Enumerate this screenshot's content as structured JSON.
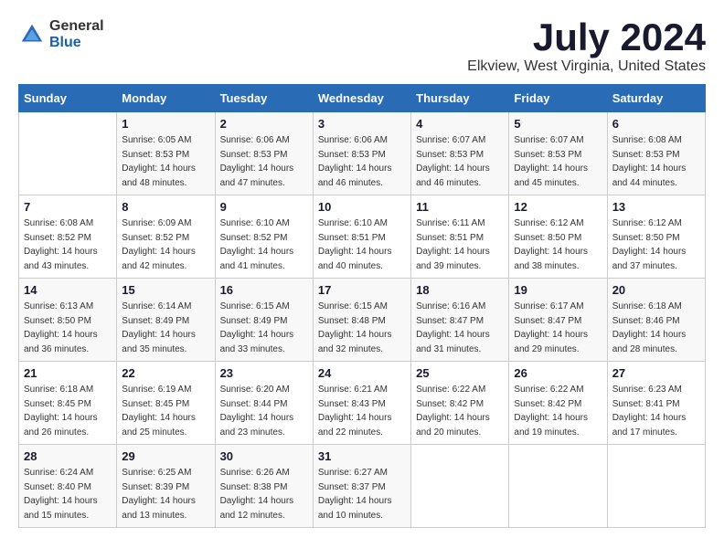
{
  "header": {
    "logo_general": "General",
    "logo_blue": "Blue",
    "month_year": "July 2024",
    "location": "Elkview, West Virginia, United States"
  },
  "weekdays": [
    "Sunday",
    "Monday",
    "Tuesday",
    "Wednesday",
    "Thursday",
    "Friday",
    "Saturday"
  ],
  "weeks": [
    [
      {
        "day": "",
        "sunrise": "",
        "sunset": "",
        "daylight": ""
      },
      {
        "day": "1",
        "sunrise": "Sunrise: 6:05 AM",
        "sunset": "Sunset: 8:53 PM",
        "daylight": "Daylight: 14 hours and 48 minutes."
      },
      {
        "day": "2",
        "sunrise": "Sunrise: 6:06 AM",
        "sunset": "Sunset: 8:53 PM",
        "daylight": "Daylight: 14 hours and 47 minutes."
      },
      {
        "day": "3",
        "sunrise": "Sunrise: 6:06 AM",
        "sunset": "Sunset: 8:53 PM",
        "daylight": "Daylight: 14 hours and 46 minutes."
      },
      {
        "day": "4",
        "sunrise": "Sunrise: 6:07 AM",
        "sunset": "Sunset: 8:53 PM",
        "daylight": "Daylight: 14 hours and 46 minutes."
      },
      {
        "day": "5",
        "sunrise": "Sunrise: 6:07 AM",
        "sunset": "Sunset: 8:53 PM",
        "daylight": "Daylight: 14 hours and 45 minutes."
      },
      {
        "day": "6",
        "sunrise": "Sunrise: 6:08 AM",
        "sunset": "Sunset: 8:53 PM",
        "daylight": "Daylight: 14 hours and 44 minutes."
      }
    ],
    [
      {
        "day": "7",
        "sunrise": "Sunrise: 6:08 AM",
        "sunset": "Sunset: 8:52 PM",
        "daylight": "Daylight: 14 hours and 43 minutes."
      },
      {
        "day": "8",
        "sunrise": "Sunrise: 6:09 AM",
        "sunset": "Sunset: 8:52 PM",
        "daylight": "Daylight: 14 hours and 42 minutes."
      },
      {
        "day": "9",
        "sunrise": "Sunrise: 6:10 AM",
        "sunset": "Sunset: 8:52 PM",
        "daylight": "Daylight: 14 hours and 41 minutes."
      },
      {
        "day": "10",
        "sunrise": "Sunrise: 6:10 AM",
        "sunset": "Sunset: 8:51 PM",
        "daylight": "Daylight: 14 hours and 40 minutes."
      },
      {
        "day": "11",
        "sunrise": "Sunrise: 6:11 AM",
        "sunset": "Sunset: 8:51 PM",
        "daylight": "Daylight: 14 hours and 39 minutes."
      },
      {
        "day": "12",
        "sunrise": "Sunrise: 6:12 AM",
        "sunset": "Sunset: 8:50 PM",
        "daylight": "Daylight: 14 hours and 38 minutes."
      },
      {
        "day": "13",
        "sunrise": "Sunrise: 6:12 AM",
        "sunset": "Sunset: 8:50 PM",
        "daylight": "Daylight: 14 hours and 37 minutes."
      }
    ],
    [
      {
        "day": "14",
        "sunrise": "Sunrise: 6:13 AM",
        "sunset": "Sunset: 8:50 PM",
        "daylight": "Daylight: 14 hours and 36 minutes."
      },
      {
        "day": "15",
        "sunrise": "Sunrise: 6:14 AM",
        "sunset": "Sunset: 8:49 PM",
        "daylight": "Daylight: 14 hours and 35 minutes."
      },
      {
        "day": "16",
        "sunrise": "Sunrise: 6:15 AM",
        "sunset": "Sunset: 8:49 PM",
        "daylight": "Daylight: 14 hours and 33 minutes."
      },
      {
        "day": "17",
        "sunrise": "Sunrise: 6:15 AM",
        "sunset": "Sunset: 8:48 PM",
        "daylight": "Daylight: 14 hours and 32 minutes."
      },
      {
        "day": "18",
        "sunrise": "Sunrise: 6:16 AM",
        "sunset": "Sunset: 8:47 PM",
        "daylight": "Daylight: 14 hours and 31 minutes."
      },
      {
        "day": "19",
        "sunrise": "Sunrise: 6:17 AM",
        "sunset": "Sunset: 8:47 PM",
        "daylight": "Daylight: 14 hours and 29 minutes."
      },
      {
        "day": "20",
        "sunrise": "Sunrise: 6:18 AM",
        "sunset": "Sunset: 8:46 PM",
        "daylight": "Daylight: 14 hours and 28 minutes."
      }
    ],
    [
      {
        "day": "21",
        "sunrise": "Sunrise: 6:18 AM",
        "sunset": "Sunset: 8:45 PM",
        "daylight": "Daylight: 14 hours and 26 minutes."
      },
      {
        "day": "22",
        "sunrise": "Sunrise: 6:19 AM",
        "sunset": "Sunset: 8:45 PM",
        "daylight": "Daylight: 14 hours and 25 minutes."
      },
      {
        "day": "23",
        "sunrise": "Sunrise: 6:20 AM",
        "sunset": "Sunset: 8:44 PM",
        "daylight": "Daylight: 14 hours and 23 minutes."
      },
      {
        "day": "24",
        "sunrise": "Sunrise: 6:21 AM",
        "sunset": "Sunset: 8:43 PM",
        "daylight": "Daylight: 14 hours and 22 minutes."
      },
      {
        "day": "25",
        "sunrise": "Sunrise: 6:22 AM",
        "sunset": "Sunset: 8:42 PM",
        "daylight": "Daylight: 14 hours and 20 minutes."
      },
      {
        "day": "26",
        "sunrise": "Sunrise: 6:22 AM",
        "sunset": "Sunset: 8:42 PM",
        "daylight": "Daylight: 14 hours and 19 minutes."
      },
      {
        "day": "27",
        "sunrise": "Sunrise: 6:23 AM",
        "sunset": "Sunset: 8:41 PM",
        "daylight": "Daylight: 14 hours and 17 minutes."
      }
    ],
    [
      {
        "day": "28",
        "sunrise": "Sunrise: 6:24 AM",
        "sunset": "Sunset: 8:40 PM",
        "daylight": "Daylight: 14 hours and 15 minutes."
      },
      {
        "day": "29",
        "sunrise": "Sunrise: 6:25 AM",
        "sunset": "Sunset: 8:39 PM",
        "daylight": "Daylight: 14 hours and 13 minutes."
      },
      {
        "day": "30",
        "sunrise": "Sunrise: 6:26 AM",
        "sunset": "Sunset: 8:38 PM",
        "daylight": "Daylight: 14 hours and 12 minutes."
      },
      {
        "day": "31",
        "sunrise": "Sunrise: 6:27 AM",
        "sunset": "Sunset: 8:37 PM",
        "daylight": "Daylight: 14 hours and 10 minutes."
      },
      {
        "day": "",
        "sunrise": "",
        "sunset": "",
        "daylight": ""
      },
      {
        "day": "",
        "sunrise": "",
        "sunset": "",
        "daylight": ""
      },
      {
        "day": "",
        "sunrise": "",
        "sunset": "",
        "daylight": ""
      }
    ]
  ]
}
